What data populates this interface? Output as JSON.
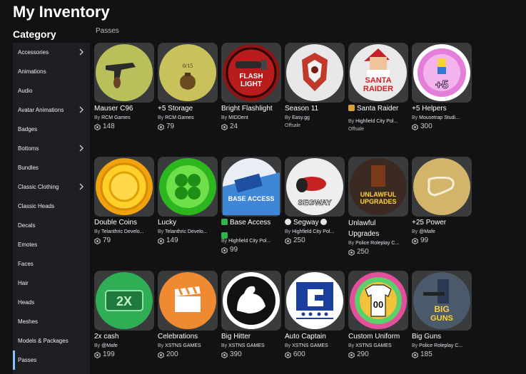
{
  "page": {
    "title": "My Inventory"
  },
  "sidebar": {
    "heading": "Category",
    "items": [
      {
        "label": "Accessories",
        "has_chevron": true,
        "active": false
      },
      {
        "label": "Animations",
        "has_chevron": false,
        "active": false
      },
      {
        "label": "Audio",
        "has_chevron": false,
        "active": false
      },
      {
        "label": "Avatar Animations",
        "has_chevron": true,
        "active": false
      },
      {
        "label": "Badges",
        "has_chevron": false,
        "active": false
      },
      {
        "label": "Bottoms",
        "has_chevron": true,
        "active": false
      },
      {
        "label": "Bundles",
        "has_chevron": false,
        "active": false
      },
      {
        "label": "Classic Clothing",
        "has_chevron": true,
        "active": false
      },
      {
        "label": "Classic Heads",
        "has_chevron": false,
        "active": false
      },
      {
        "label": "Decals",
        "has_chevron": false,
        "active": false
      },
      {
        "label": "Emotes",
        "has_chevron": false,
        "active": false
      },
      {
        "label": "Faces",
        "has_chevron": false,
        "active": false
      },
      {
        "label": "Hair",
        "has_chevron": false,
        "active": false
      },
      {
        "label": "Heads",
        "has_chevron": false,
        "active": false
      },
      {
        "label": "Meshes",
        "has_chevron": false,
        "active": false
      },
      {
        "label": "Models & Packages",
        "has_chevron": false,
        "active": false
      },
      {
        "label": "Passes",
        "has_chevron": false,
        "active": true
      }
    ]
  },
  "section": {
    "label": "Passes"
  },
  "by_prefix": "By",
  "items": [
    {
      "name": "Mauser C96",
      "creator": "RCM Games",
      "price": "148",
      "icon": "mauser-pistol-icon"
    },
    {
      "name": "+5 Storage",
      "creator": "RCM Games",
      "price": "79",
      "icon": "storage-sack-icon"
    },
    {
      "name": "Bright Flashlight",
      "creator": "MIDDent",
      "price": "24",
      "icon": "flashlight-icon"
    },
    {
      "name": "Season 11",
      "creator": "Easy.gg",
      "price": "",
      "status": "Offsale",
      "icon": "season-emblem-icon"
    },
    {
      "name": "Santa Raider",
      "creator": "Highfield City Pol...",
      "price": "",
      "status": "Offsale",
      "icon": "santa-raider-icon",
      "badge": "gift"
    },
    {
      "name": "+5 Helpers",
      "creator": "Mousetrap Studi...",
      "price": "300",
      "icon": "helpers-plus-five-icon"
    },
    {
      "name": "Double Coins",
      "creator": "Telanthric Develo...",
      "price": "79",
      "icon": "gold-coin-icon"
    },
    {
      "name": "Lucky",
      "creator": "Telanthric Develo...",
      "price": "149",
      "icon": "clover-icon"
    },
    {
      "name": "Base Access",
      "creator": "Highfield City Pol...",
      "price": "99",
      "icon": "base-access-card-icon",
      "badge": "green",
      "extra_badge": "green"
    },
    {
      "name": "Segway",
      "creator": "Highfield City Pol...",
      "price": "250",
      "icon": "segway-icon",
      "badge": "white",
      "trailing_badge": "white"
    },
    {
      "name": "Unlawful Upgrades",
      "creator": "Police Roleplay C...",
      "price": "250",
      "icon": "unlawful-upgrades-icon",
      "wrap": true
    },
    {
      "name": "+25 Power",
      "creator": "@Mafe",
      "price": "99",
      "icon": "power-boot-icon"
    },
    {
      "name": "2x cash",
      "creator": "@Mafe",
      "price": "199",
      "icon": "two-x-cash-icon"
    },
    {
      "name": "Celebrations",
      "creator": "XSTNS GAMES",
      "price": "200",
      "icon": "clapperboard-icon"
    },
    {
      "name": "Big Hitter",
      "creator": "XSTNS GAMES",
      "price": "390",
      "icon": "flexed-arm-icon"
    },
    {
      "name": "Auto Captain",
      "creator": "XSTNS GAMES",
      "price": "600",
      "icon": "captain-armband-icon"
    },
    {
      "name": "Custom Uniform",
      "creator": "XSTNS GAMES",
      "price": "290",
      "icon": "jersey-icon"
    },
    {
      "name": "Big Guns",
      "creator": "Police Roleplay C...",
      "price": "185",
      "icon": "big-guns-icon"
    }
  ],
  "thumb_texts": {
    "flashlight": [
      "FLASH",
      "LIGHT"
    ],
    "santa": [
      "SANTA",
      "RAIDER"
    ],
    "helpers": "+5",
    "storage": "0/15",
    "base_access": "BASE ACCESS",
    "segway": "SEGWAY",
    "unlawful": [
      "UNLAWFUL",
      "UPGRADES"
    ],
    "cash": "2X",
    "jersey": "00",
    "big_guns": [
      "BIG",
      "GUNS"
    ]
  },
  "colors": {
    "background": "#121215",
    "sidebar": "#1e1f23",
    "card": "#393b3d",
    "active_accent": "#87c4ff"
  }
}
